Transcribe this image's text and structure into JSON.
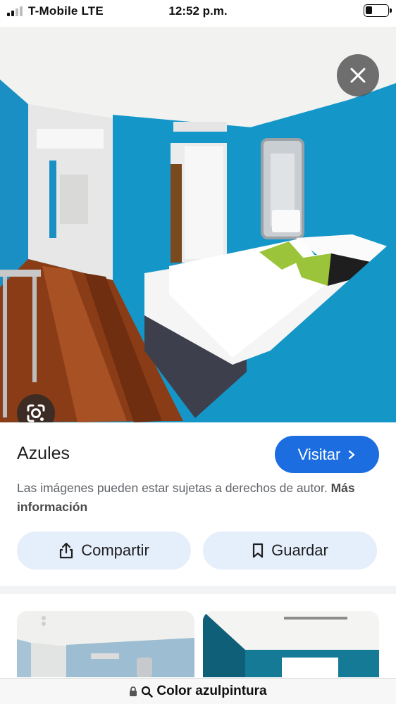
{
  "status_bar": {
    "carrier": "T-Mobile  LTE",
    "time": "12:52 p.m.",
    "signal_bars_active": 2,
    "signal_bars_total": 4,
    "battery_level": 0.3
  },
  "viewer": {
    "close_icon": "close-icon",
    "lens_icon": "google-lens-icon",
    "title": "Azules",
    "visit_label": "Visitar",
    "visit_icon": "chevron-right-icon",
    "copyright_notice": "Las imágenes pueden estar sujetas a derechos de autor.",
    "more_info_link": "Más información",
    "share_label": "Compartir",
    "share_icon": "share-icon",
    "save_label": "Guardar",
    "save_icon": "bookmark-icon"
  },
  "browser": {
    "lock_icon": "lock-icon",
    "search_icon": "search-icon",
    "url_text": "Color azulpintura"
  },
  "colors": {
    "accent": "#1b6de0",
    "pill_bg": "#e5eefb",
    "wall_blue": "#1497c8"
  }
}
